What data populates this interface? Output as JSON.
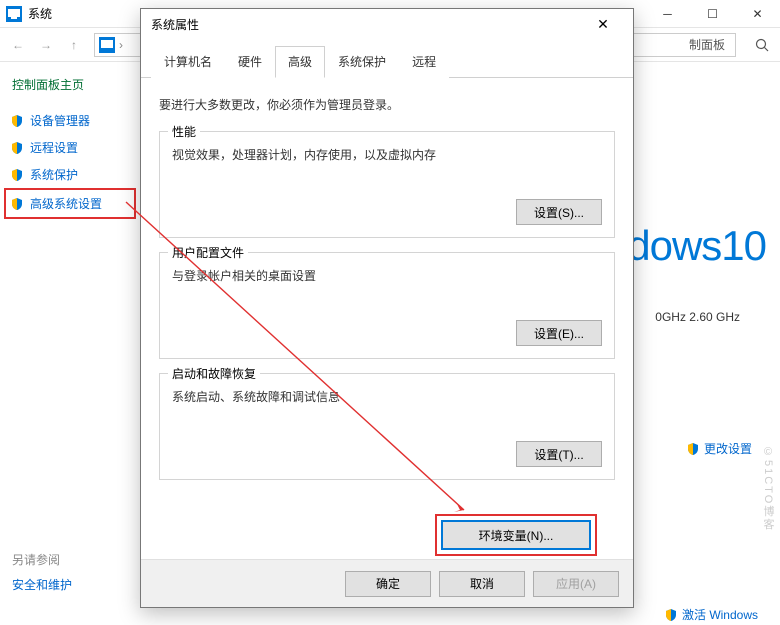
{
  "bg": {
    "title": "系统",
    "address_text": "制面板",
    "sidebar_title": "控制面板主页",
    "sidebar": [
      {
        "label": "设备管理器"
      },
      {
        "label": "远程设置"
      },
      {
        "label": "系统保护"
      },
      {
        "label": "高级系统设置",
        "highlight": true
      }
    ],
    "see_also_label": "另请参阅",
    "see_also_link": "安全和维护",
    "brand": "dows10",
    "cpu": "0GHz  2.60 GHz",
    "change_settings": "更改设置",
    "activate": "激活 Windows",
    "watermark": "©51CTO博客"
  },
  "dialog": {
    "title": "系统属性",
    "tabs": [
      "计算机名",
      "硬件",
      "高级",
      "系统保护",
      "远程"
    ],
    "active_tab": 2,
    "intro": "要进行大多数更改，你必须作为管理员登录。",
    "groups": [
      {
        "title": "性能",
        "desc": "视觉效果，处理器计划，内存使用，以及虚拟内存",
        "btn": "设置(S)..."
      },
      {
        "title": "用户配置文件",
        "desc": "与登录帐户相关的桌面设置",
        "btn": "设置(E)..."
      },
      {
        "title": "启动和故障恢复",
        "desc": "系统启动、系统故障和调试信息",
        "btn": "设置(T)..."
      }
    ],
    "env_btn": "环境变量(N)...",
    "ok": "确定",
    "cancel": "取消",
    "apply": "应用(A)"
  }
}
